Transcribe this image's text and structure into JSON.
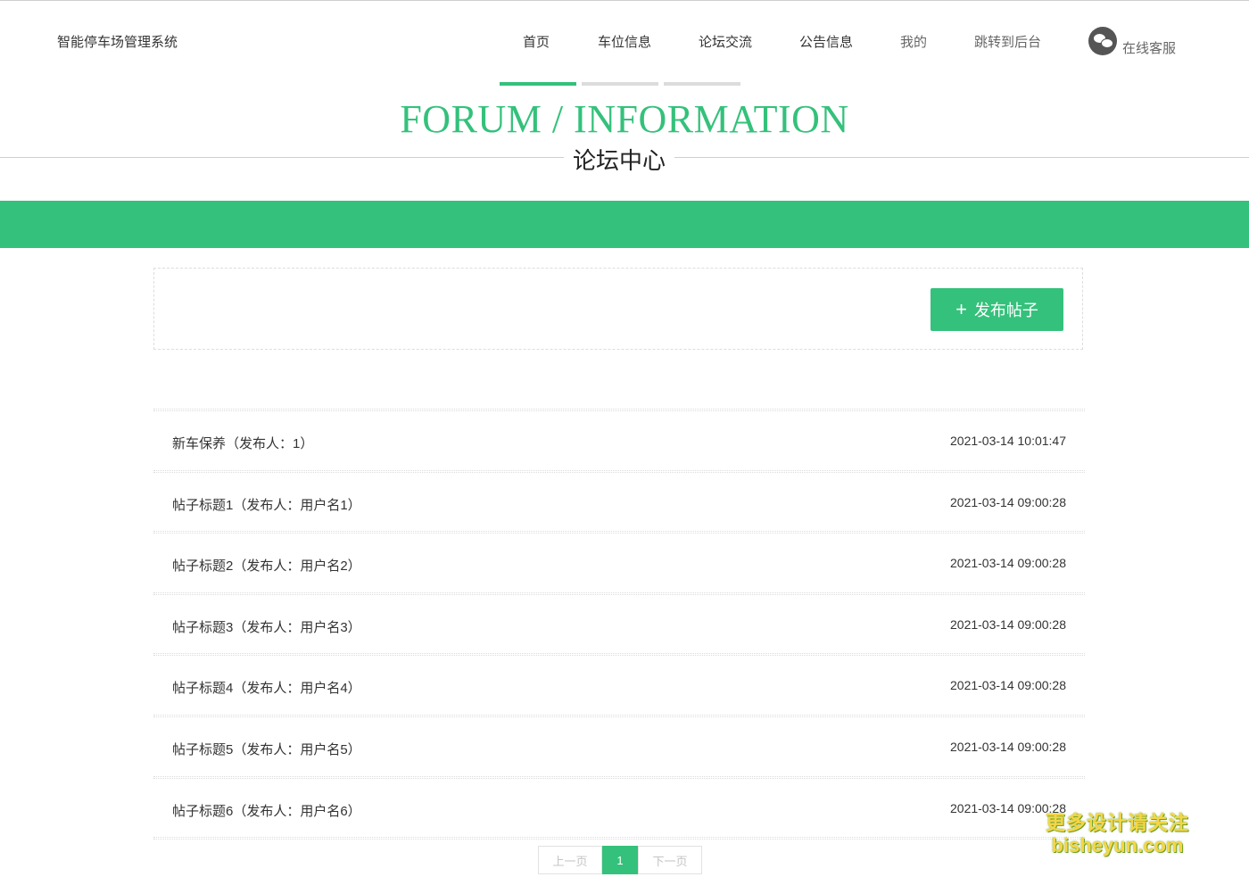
{
  "brand": "智能停车场管理系统",
  "nav": {
    "items": [
      "首页",
      "车位信息",
      "论坛交流",
      "公告信息",
      "我的",
      "跳转到后台"
    ],
    "service": "在线客服"
  },
  "section": {
    "title_en": "FORUM / INFORMATION",
    "title_cn": "论坛中心"
  },
  "toolbar": {
    "publish_label": "发布帖子"
  },
  "posts": [
    {
      "title": "新车保养（发布人：1）",
      "time": "2021-03-14 10:01:47"
    },
    {
      "title": "帖子标题1（发布人：用户名1）",
      "time": "2021-03-14 09:00:28"
    },
    {
      "title": "帖子标题2（发布人：用户名2）",
      "time": "2021-03-14 09:00:28"
    },
    {
      "title": "帖子标题3（发布人：用户名3）",
      "time": "2021-03-14 09:00:28"
    },
    {
      "title": "帖子标题4（发布人：用户名4）",
      "time": "2021-03-14 09:00:28"
    },
    {
      "title": "帖子标题5（发布人：用户名5）",
      "time": "2021-03-14 09:00:28"
    },
    {
      "title": "帖子标题6（发布人：用户名6）",
      "time": "2021-03-14 09:00:28"
    }
  ],
  "pagination": {
    "prev": "上一页",
    "current": "1",
    "next": "下一页"
  },
  "watermark": {
    "line1": "更多设计请关注",
    "line2": "bisheyun.com"
  },
  "colors": {
    "accent": "#34c17b",
    "tab_inactive": "#dcdcdc"
  },
  "icons": {
    "service": "wechat-icon",
    "publish": "plus-icon"
  }
}
